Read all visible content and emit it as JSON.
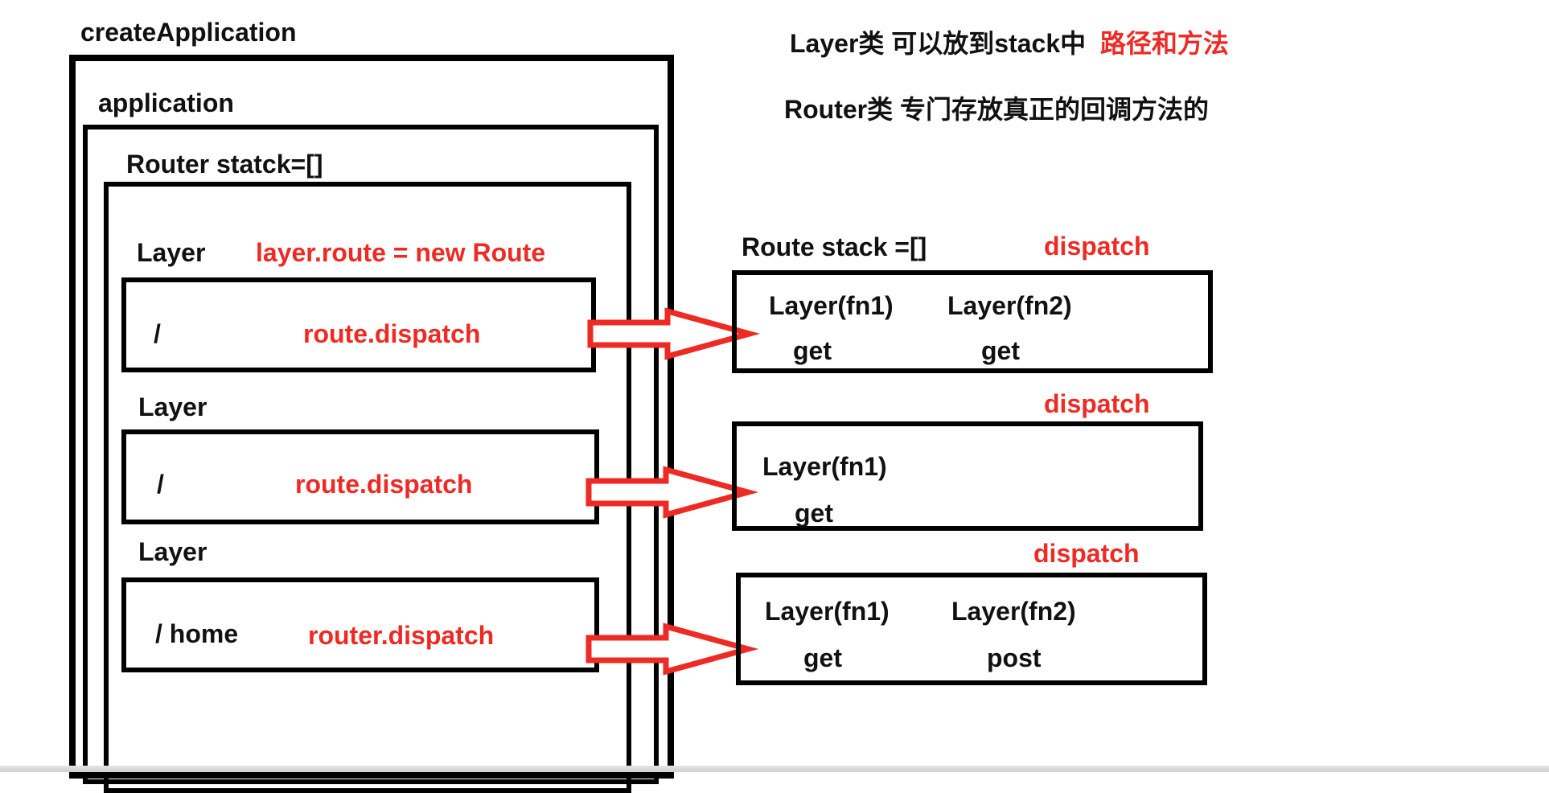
{
  "container_labels": {
    "create_application": "createApplication",
    "application": "application",
    "router": "Router   statck=[]"
  },
  "notes": {
    "layer_note": "Layer类 可以放到stack中",
    "layer_note_red": "路径和方法",
    "router_note": "Router类 专门存放真正的回调方法的"
  },
  "layers": [
    {
      "label": "Layer",
      "annotation": "layer.route = new Route",
      "path": "/",
      "dispatch": "route.dispatch"
    },
    {
      "label": "Layer",
      "path": "/",
      "dispatch": "route.dispatch"
    },
    {
      "label": "Layer",
      "path": "/ home",
      "dispatch": "router.dispatch"
    }
  ],
  "routes_header": "Route  stack =[]",
  "routes": [
    {
      "dispatch": "dispatch",
      "layers": [
        {
          "name": "Layer(fn1)",
          "method": "get"
        },
        {
          "name": "Layer(fn2)",
          "method": "get"
        }
      ]
    },
    {
      "dispatch": "dispatch",
      "layers": [
        {
          "name": "Layer(fn1)",
          "method": "get"
        }
      ]
    },
    {
      "dispatch": "dispatch",
      "layers": [
        {
          "name": "Layer(fn1)",
          "method": "get"
        },
        {
          "name": "Layer(fn2)",
          "method": "post"
        }
      ]
    }
  ],
  "colors": {
    "accent_red": "#ee2a24",
    "border": "#000000"
  }
}
